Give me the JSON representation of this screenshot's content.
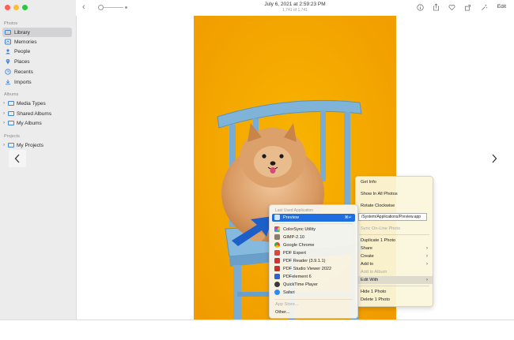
{
  "sidebar": {
    "sections": {
      "photos": "Photos",
      "albums": "Albums",
      "projects": "Projects"
    },
    "items": [
      {
        "label": "Library"
      },
      {
        "label": "Memories"
      },
      {
        "label": "People"
      },
      {
        "label": "Places"
      },
      {
        "label": "Recents"
      },
      {
        "label": "Imports"
      }
    ],
    "album_items": [
      {
        "label": "Media Types"
      },
      {
        "label": "Shared Albums"
      },
      {
        "label": "My Albums"
      }
    ],
    "project_items": [
      {
        "label": "My Projects"
      }
    ]
  },
  "toolbar": {
    "date": "July 6, 2021 at 2:59:23 PM",
    "count": "1,741 of 1,741",
    "edit": "Edit"
  },
  "context_menu": {
    "items": [
      "Get Info",
      "Show In All Photos",
      "Rotate Clockwise",
      "Sync On-Line Photo",
      "Duplicate 1 Photo",
      "Share",
      "Create",
      "Add to",
      "Add to Album",
      "Edit With",
      "Hide 1 Photo",
      "Delete 1 Photo"
    ],
    "tooltip": "/System/Applications/Preview.app"
  },
  "submenu": {
    "header": "Last Used Application",
    "selected": "Preview",
    "shortcut": "⌘↵",
    "apps": [
      "ColorSync Utility",
      "GIMP-2.10",
      "Google Chrome",
      "PDF Expert",
      "PDF Reader (3.9.1.1)",
      "PDF Studio Viewer 2022",
      "PDFelement 6",
      "QuickTime Player",
      "Safari"
    ],
    "app_store": "App Store...",
    "other": "Other..."
  },
  "colors": {
    "accent": "#1e6ee0",
    "photo_background": "#f6a800",
    "chair": "#7fb3d8"
  },
  "icons": [
    "back-icon",
    "info-icon",
    "share-icon",
    "heart-icon",
    "rotate-icon",
    "enhance-icon",
    "chevron-left-icon",
    "chevron-right-icon"
  ]
}
